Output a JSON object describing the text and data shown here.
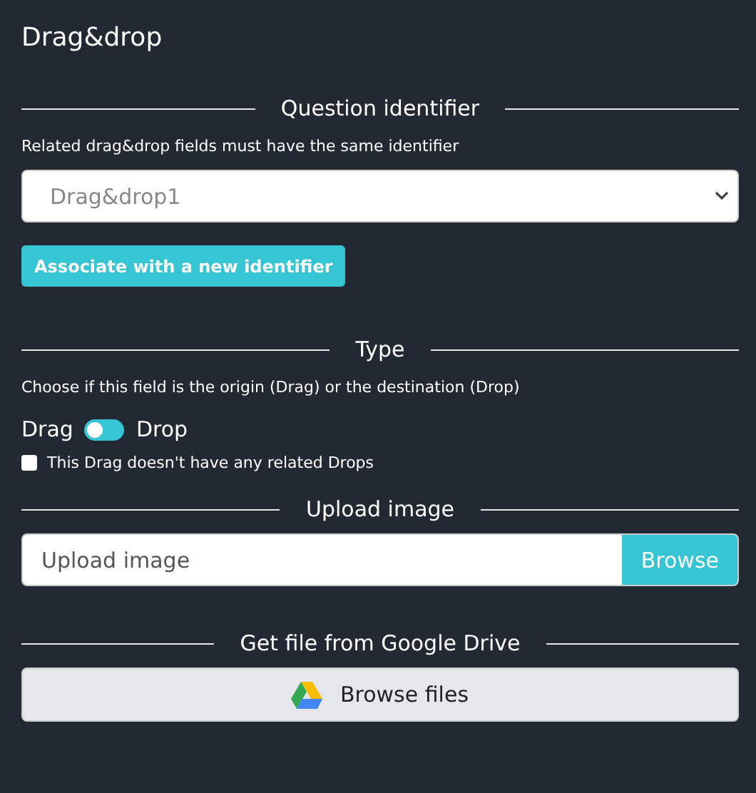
{
  "title": "Drag&drop",
  "identifier": {
    "heading": "Question identifier",
    "hint": "Related drag&drop fields must have the same identifier",
    "select_value": "Drag&drop1",
    "button": "Associate with a new identifier"
  },
  "type": {
    "heading": "Type",
    "hint": "Choose if this field is the origin (Drag) or the destination (Drop)",
    "left_label": "Drag",
    "right_label": "Drop",
    "switch_on": false,
    "checkbox": {
      "label": "This Drag doesn't have any related Drops",
      "checked": false
    }
  },
  "upload": {
    "heading": "Upload image",
    "placeholder": "Upload image",
    "button": "Browse"
  },
  "drive": {
    "heading": "Get file from Google Drive",
    "button": "Browse files"
  }
}
